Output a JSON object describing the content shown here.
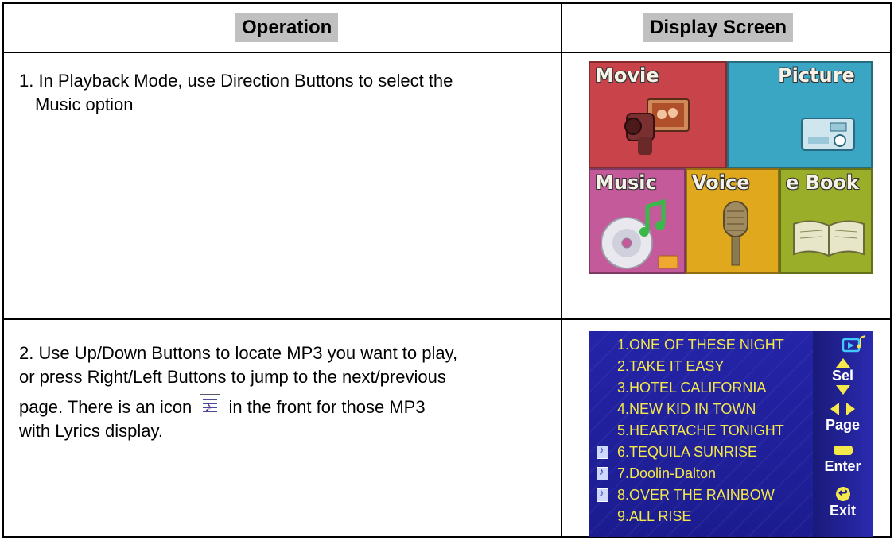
{
  "table": {
    "headers": {
      "operation": "Operation",
      "display": "Display Screen"
    },
    "rows": [
      {
        "step_line1": "1. In Playback Mode, use Direction Buttons to select the",
        "step_line2": "Music option"
      },
      {
        "line1": "2. Use Up/Down Buttons to locate MP3 you want to play,",
        "line2": "or press Right/Left Buttons to jump to the next/previous",
        "line3a": "page. There is an icon",
        "line3b": "in the front for those MP3",
        "line4": "with Lyrics display.",
        "icon": "lyrics-file-icon"
      }
    ]
  },
  "menu_screen": {
    "tiles": [
      {
        "label": "Movie",
        "color": "#c8444a",
        "icon": "camcorder-icon"
      },
      {
        "label": "Picture",
        "color": "#3aa6c4",
        "icon": "camera-icon"
      },
      {
        "label": "Music",
        "color": "#c45a9a",
        "icon": "cd-music-icon"
      },
      {
        "label": "Voice",
        "color": "#e0a81c",
        "icon": "microphone-icon"
      },
      {
        "label": "e Book",
        "color": "#9aae2a",
        "icon": "book-icon"
      }
    ]
  },
  "music_list": {
    "items": [
      {
        "text": "1.ONE OF THESE NIGHT",
        "lyrics": false
      },
      {
        "text": "2.TAKE IT EASY",
        "lyrics": false
      },
      {
        "text": "3.HOTEL CALIFORNIA",
        "lyrics": false
      },
      {
        "text": "4.NEW KID IN TOWN",
        "lyrics": false
      },
      {
        "text": "5.HEARTACHE TONIGHT",
        "lyrics": false
      },
      {
        "text": "6.TEQUILA SUNRISE",
        "lyrics": true
      },
      {
        "text": "7.Doolin-Dalton",
        "lyrics": true
      },
      {
        "text": "8.OVER THE RAINBOW",
        "lyrics": true
      },
      {
        "text": "9.ALL RISE",
        "lyrics": false
      }
    ],
    "controls": {
      "sel": "Sel",
      "page": "Page",
      "enter": "Enter",
      "exit": "Exit"
    },
    "colors": {
      "item_text": "#f4e84a",
      "background": "#2424a8"
    }
  }
}
